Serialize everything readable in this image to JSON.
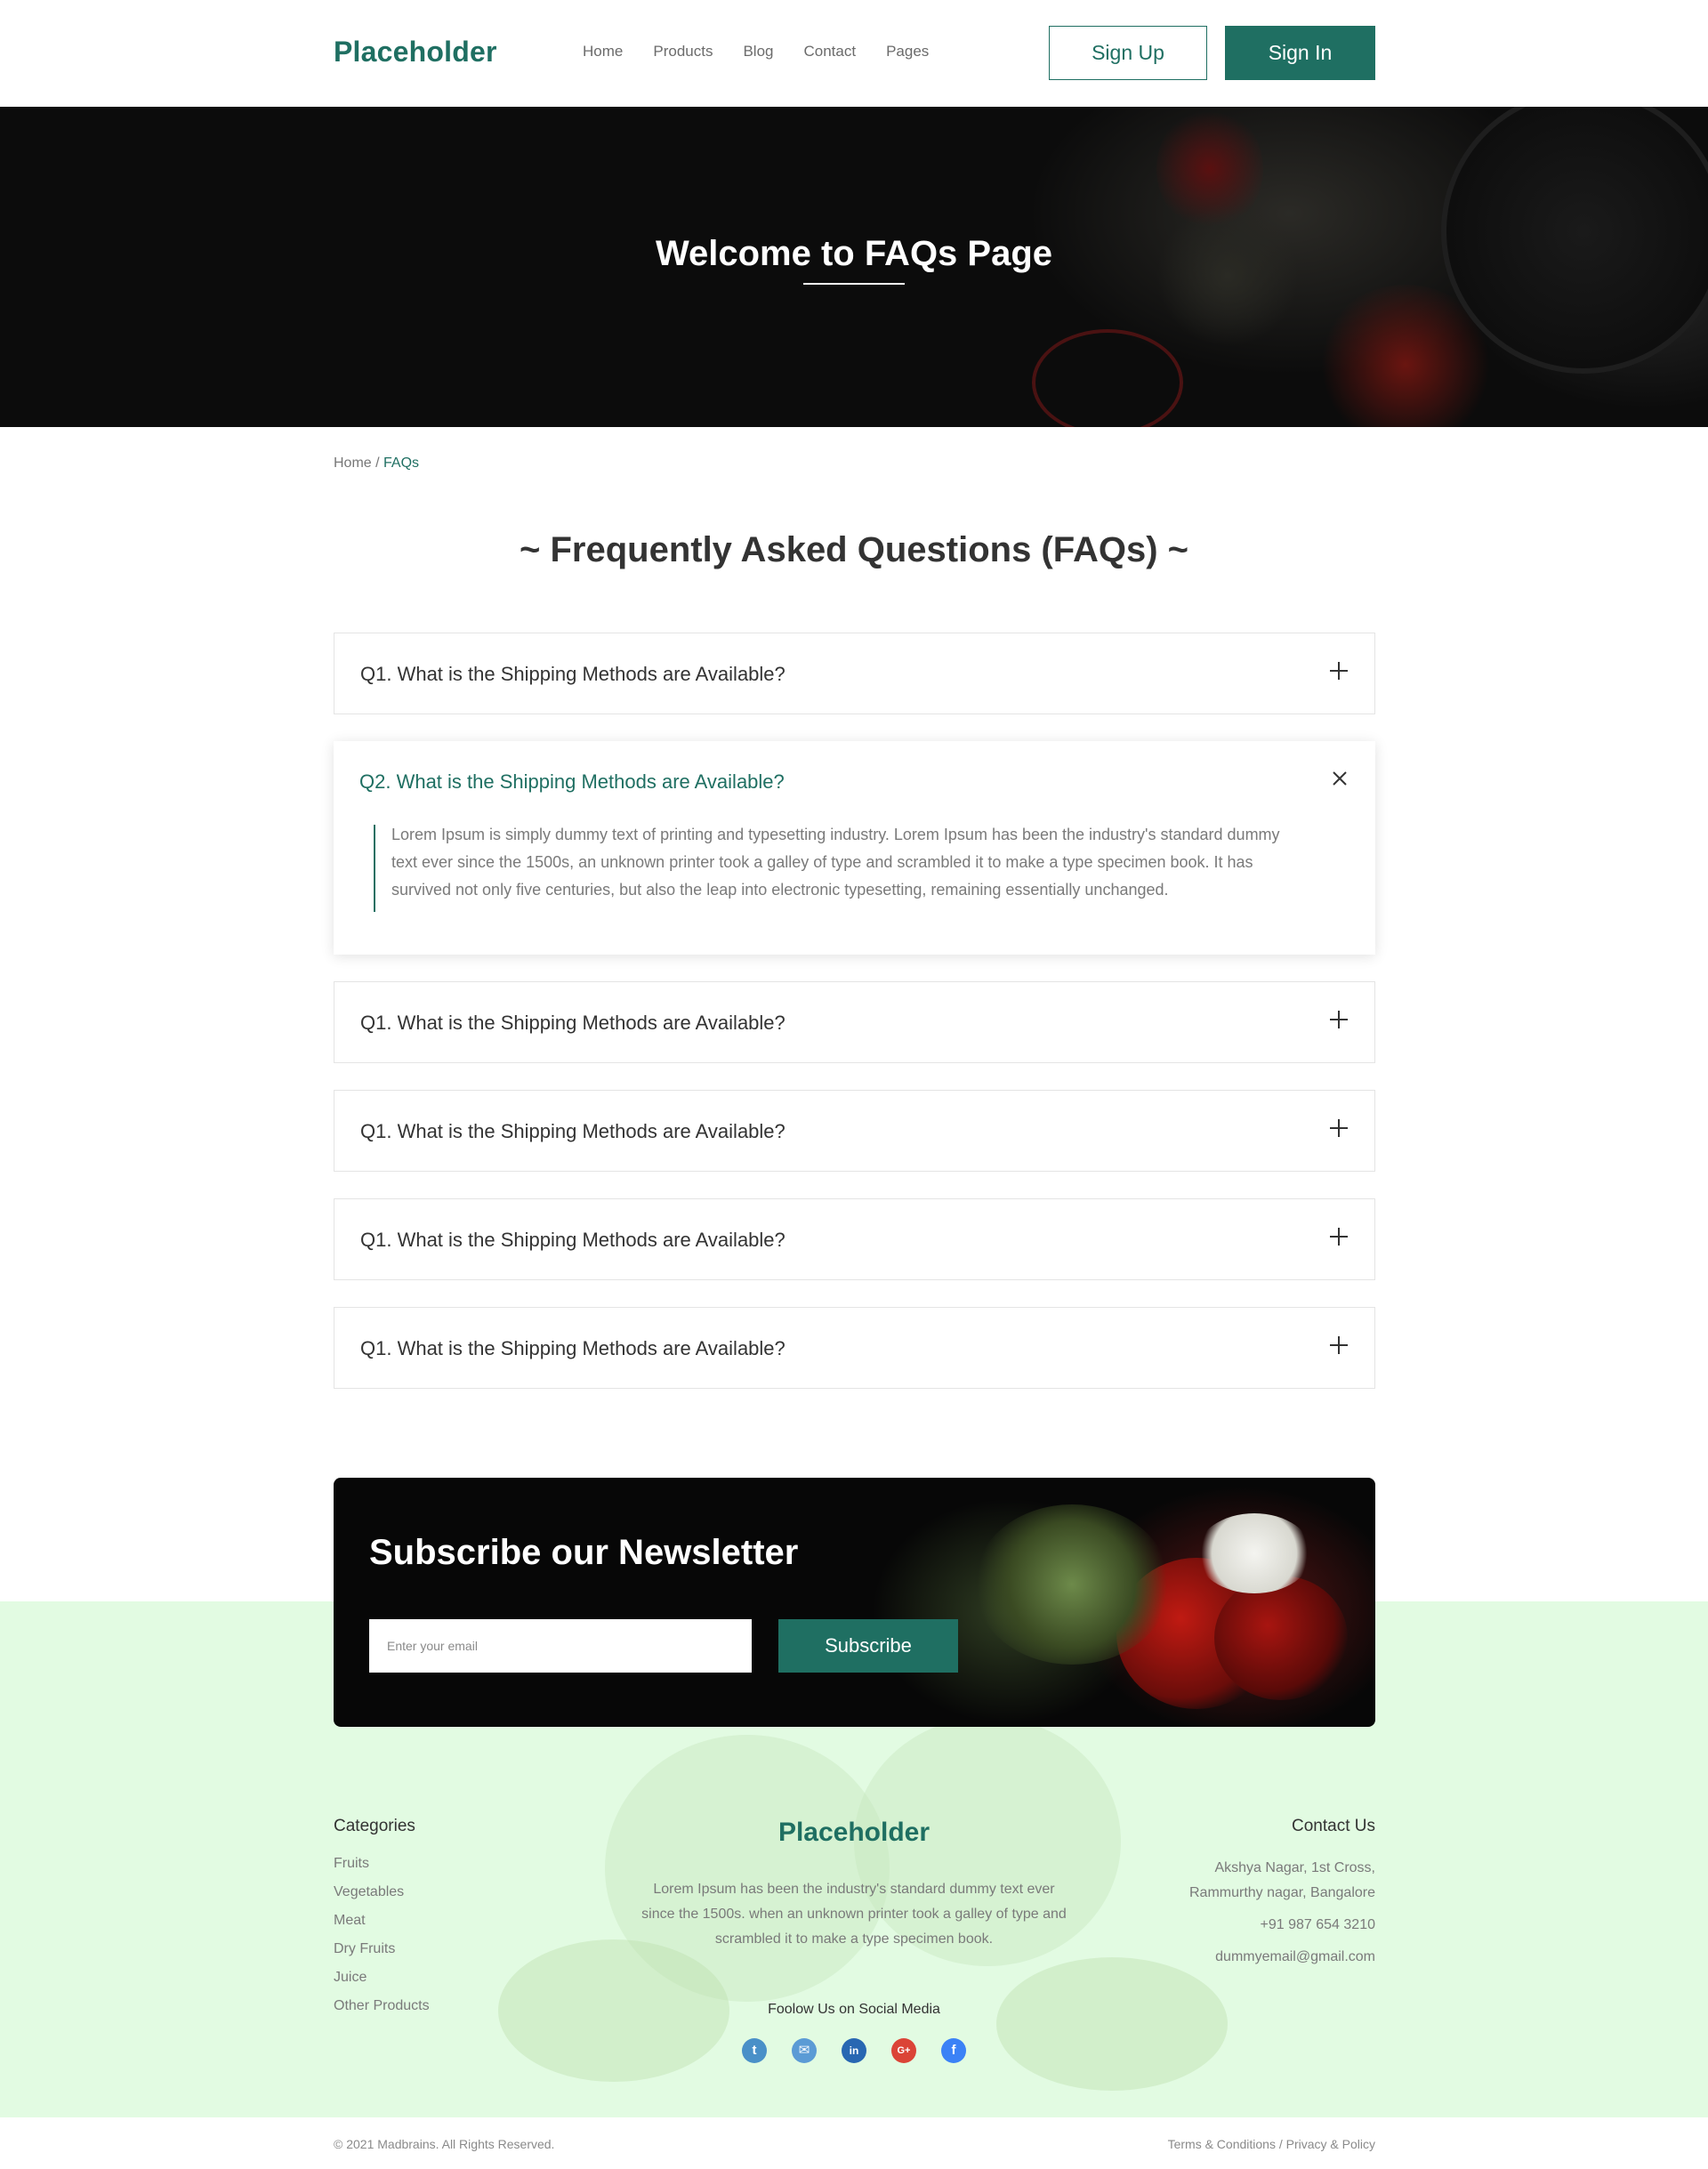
{
  "header": {
    "logo": "Placeholder",
    "nav": [
      "Home",
      "Products",
      "Blog",
      "Contact",
      "Pages"
    ],
    "sign_up": "Sign Up",
    "sign_in": "Sign In"
  },
  "hero": {
    "title": "Welcome to FAQs Page"
  },
  "breadcrumb": {
    "home": "Home",
    "separator": " / ",
    "current": "FAQs"
  },
  "faq": {
    "title": "~ Frequently Asked Questions (FAQs) ~",
    "items": [
      {
        "question": "Q1. What is the Shipping Methods are Available?",
        "open": false
      },
      {
        "question": "Q2. What is the Shipping Methods are Available?",
        "open": true,
        "answer": "Lorem Ipsum is simply dummy text of printing and typesetting industry. Lorem Ipsum has been the industry's standard dummy text ever since the 1500s, an unknown printer took a galley of type and scrambled it to make a type specimen book. It has survived not only five centuries, but also the leap into electronic typesetting, remaining essentially unchanged."
      },
      {
        "question": "Q1. What is the Shipping Methods are Available?",
        "open": false
      },
      {
        "question": "Q1. What is the Shipping Methods are Available?",
        "open": false
      },
      {
        "question": "Q1. What is the Shipping Methods are Available?",
        "open": false
      },
      {
        "question": "Q1. What is the Shipping Methods are Available?",
        "open": false
      }
    ]
  },
  "newsletter": {
    "title": "Subscribe our Newsletter",
    "placeholder": "Enter your email",
    "button": "Subscribe"
  },
  "footer": {
    "categories_title": "Categories",
    "categories": [
      "Fruits",
      "Vegetables",
      "Meat",
      "Dry Fruits",
      "Juice",
      "Other Products"
    ],
    "logo": "Placeholder",
    "description": "Lorem Ipsum has been the industry's standard dummy text ever since the 1500s. when an unknown printer took a galley of type and scrambled it to make a type specimen book.",
    "follow": "Foolow Us on Social Media",
    "socials": [
      {
        "icon": "twitter-icon",
        "glyph": "t",
        "color": "#4a90c8"
      },
      {
        "icon": "mail-icon",
        "glyph": "✉",
        "color": "#5b9bd5"
      },
      {
        "icon": "linkedin-icon",
        "glyph": "in",
        "color": "#2867b2"
      },
      {
        "icon": "google-plus-icon",
        "glyph": "G+",
        "color": "#db4437"
      },
      {
        "icon": "facebook-icon",
        "glyph": "f",
        "color": "#3b82f6"
      }
    ],
    "contact_title": "Contact Us",
    "address_line1": "Akshya Nagar, 1st Cross,",
    "address_line2": "Rammurthy nagar, Bangalore",
    "phone": "+91 987 654 3210",
    "email": "dummyemail@gmail.com"
  },
  "bottom": {
    "copyright": "© 2021 Madbrains. All Rights Reserved.",
    "terms": "Terms & Conditions",
    "separator": " / ",
    "privacy": "Privacy & Policy"
  },
  "colors": {
    "brand": "#1f6f62",
    "footer_bg": "#e2fbe2"
  }
}
